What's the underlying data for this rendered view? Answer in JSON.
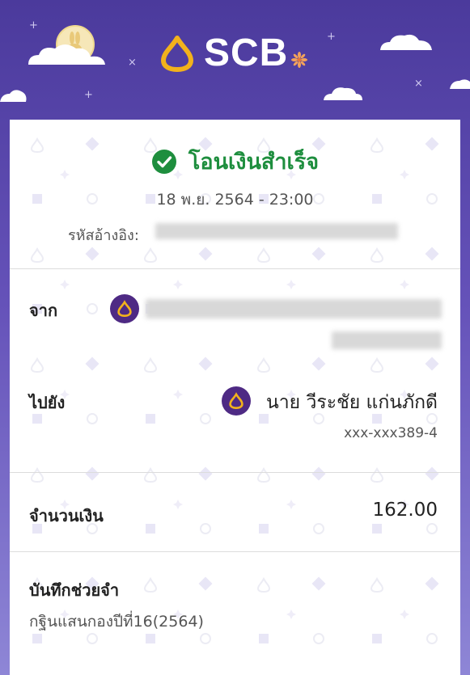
{
  "brand": {
    "name": "SCB"
  },
  "status": {
    "title": "โอนเงินสำเร็จ",
    "datetime": "18 พ.ย. 2564 - 23:00"
  },
  "reference": {
    "label": "รหัสอ้างอิง:"
  },
  "from": {
    "label": "จาก"
  },
  "to": {
    "label": "ไปยัง",
    "name": "นาย วีระชัย แก่นภักดี",
    "account": "xxx-xxx389-4"
  },
  "amount": {
    "label": "จำนวนเงิน",
    "value": "162.00"
  },
  "memo": {
    "label": "บันทึกช่วยจำ",
    "value": "กฐินแสนกองปีที่16(2564)"
  },
  "colors": {
    "success": "#1e8e3e",
    "brand_purple": "#4e2a84",
    "brand_gold": "#f2b21c"
  },
  "icons": [
    "scb-logo-icon",
    "moon-rabbit-icon",
    "flower-icon",
    "check-circle-icon",
    "scb-badge-icon"
  ]
}
